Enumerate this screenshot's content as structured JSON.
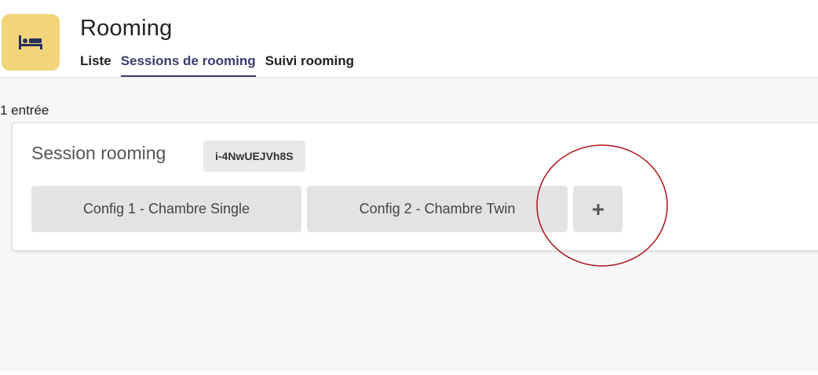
{
  "header": {
    "app_title": "Rooming",
    "app_icon": "bed-icon",
    "tabs": [
      {
        "label": "Liste",
        "active": false
      },
      {
        "label": "Sessions de rooming",
        "active": true
      },
      {
        "label": "Suivi rooming",
        "active": false
      }
    ]
  },
  "main": {
    "count_label": "1 entrée",
    "session": {
      "title": "Session rooming",
      "id": "i-4NwUEJVh8S",
      "configs": [
        {
          "label": "Config 1 - Chambre Single"
        },
        {
          "label": "Config 2 - Chambre Twin"
        }
      ],
      "add_icon": "plus-icon"
    }
  },
  "colors": {
    "app_icon_bg": "#f2d47a",
    "active_tab": "#3b3b6b",
    "annotation": "#b0151c"
  }
}
